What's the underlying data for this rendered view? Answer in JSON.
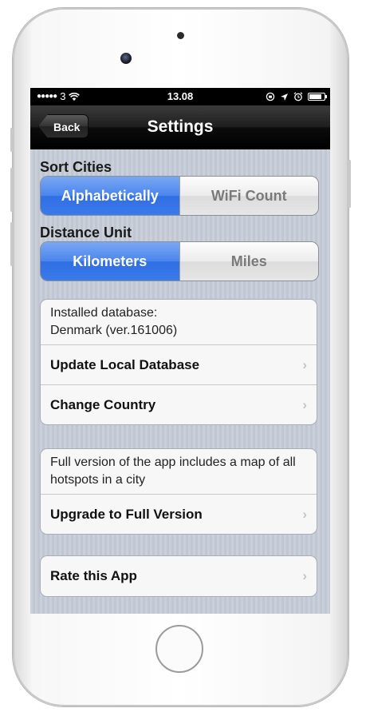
{
  "status": {
    "carrier": "3",
    "time": "13.08",
    "battery_level": 0.9
  },
  "nav": {
    "title": "Settings",
    "back_label": "Back"
  },
  "sort_cities": {
    "label": "Sort Cities",
    "options": [
      {
        "label": "Alphabetically",
        "selected": true
      },
      {
        "label": "WiFi Count",
        "selected": false
      }
    ]
  },
  "distance_unit": {
    "label": "Distance Unit",
    "options": [
      {
        "label": "Kilometers",
        "selected": true
      },
      {
        "label": "Miles",
        "selected": false
      }
    ]
  },
  "database_group": {
    "info_line1": "Installed database:",
    "info_line2": "Denmark (ver.161006)",
    "update_label": "Update Local Database",
    "change_country_label": "Change Country"
  },
  "upgrade_group": {
    "info": "Full version of the app includes a map of all hotspots in a city",
    "upgrade_label": "Upgrade to Full Version"
  },
  "rate_group": {
    "rate_label": "Rate this App"
  },
  "chevron_glyph": "›",
  "colors": {
    "selected_segment": "#3b7aea",
    "navbar": "#000000",
    "background": "#c5ccd7"
  }
}
